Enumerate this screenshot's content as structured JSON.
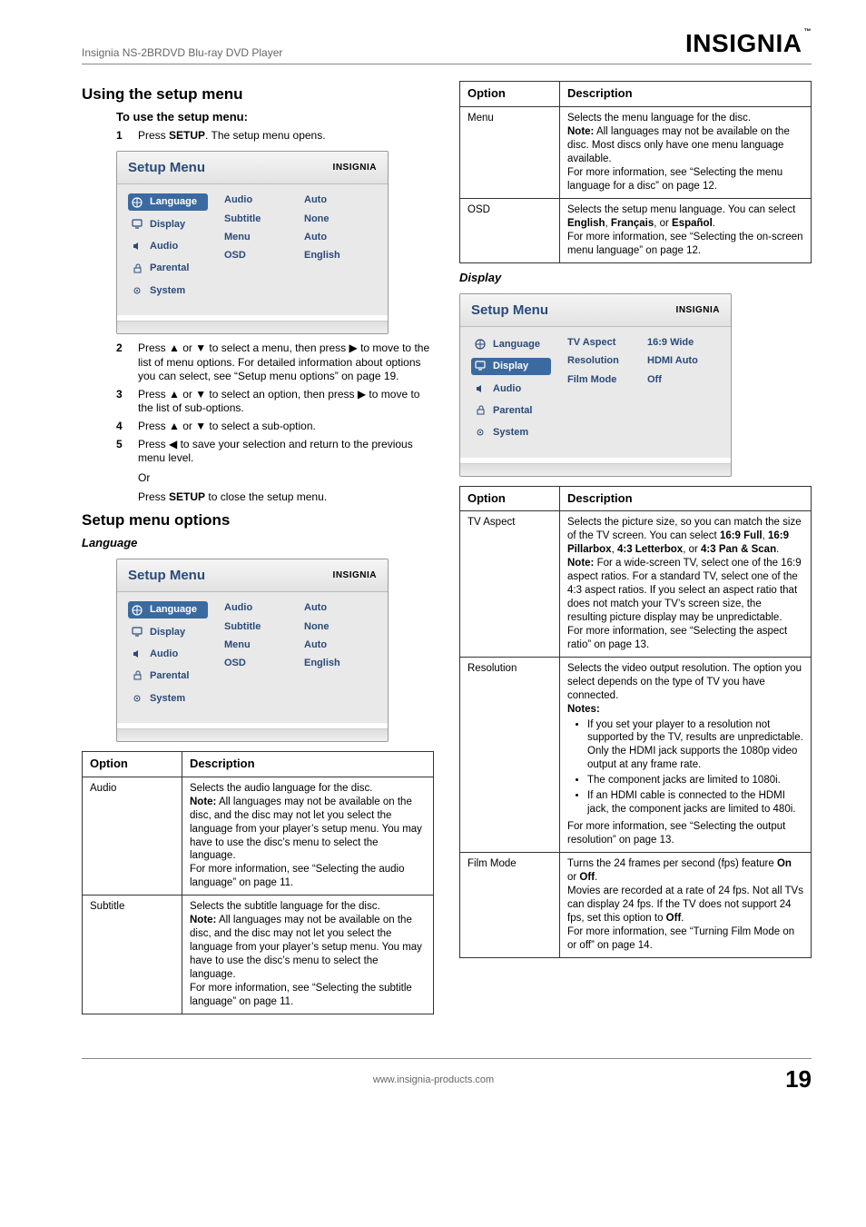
{
  "header": {
    "title": "Insignia NS-2BRDVD Blu-ray DVD Player",
    "brand": "INSIGNIA",
    "tm": "™"
  },
  "left": {
    "section_title": "Using the setup menu",
    "sub_title": "To use the setup menu:",
    "steps": {
      "s1": "Press SETUP. The setup menu opens.",
      "s1_pre": "Press ",
      "s1_bold": "SETUP",
      "s1_post": ". The setup menu opens.",
      "s2": "Press ▲ or ▼ to select a menu, then press ▶ to move to the list of menu options. For detailed information about options you can select, see “Setup menu options” on page 19.",
      "s3": "Press ▲ or ▼ to select an option, then press ▶ to move to the list of sub-options.",
      "s4": "Press ▲ or ▼ to select a sub-option.",
      "s5": "Press ◀ to save your selection and return to the previous menu level.",
      "or": "Or",
      "or2_pre": "Press ",
      "or2_bold": "SETUP",
      "or2_post": " to close the setup menu."
    },
    "options_title": "Setup menu options",
    "lang_heading": "Language",
    "table_headers": {
      "option": "Option",
      "description": "Description"
    },
    "rows": {
      "audio": {
        "name": "Audio",
        "p1": "Selects the audio language for the disc.",
        "note_label": "Note:",
        "note": " All languages may not be available on the disc, and the disc may not let you select the language from your player’s setup menu. You may have to use the disc’s menu to select the language.",
        "p2": "For more information, see “Selecting the audio language” on page 11."
      },
      "subtitle": {
        "name": "Subtitle",
        "p1": "Selects the subtitle language for the disc.",
        "note_label": "Note:",
        "note": " All languages may not be available on the disc, and the disc may not let you select the language from your player’s setup menu. You may have to use the disc’s menu to select the language.",
        "p2": "For more information, see “Selecting the subtitle language” on page 11."
      }
    }
  },
  "right": {
    "rows1": {
      "menu": {
        "name": "Menu",
        "p1": "Selects the menu language for the disc.",
        "note_label": "Note:",
        "note": " All languages may not be available on the disc. Most discs only have one menu language available.",
        "p2": "For more information, see “Selecting the menu language for a disc” on page 12."
      },
      "osd": {
        "name": "OSD",
        "p1_pre": "Selects the setup menu language. You can select ",
        "p1_b1": "English",
        "p1_c1": ", ",
        "p1_b2": "Français",
        "p1_c2": ", or ",
        "p1_b3": "Español",
        "p1_post": ".",
        "p2": "For more information, see “Selecting the on-screen menu language” on page 12."
      }
    },
    "display_heading": "Display",
    "table_headers": {
      "option": "Option",
      "description": "Description"
    },
    "rows2": {
      "tvaspect": {
        "name": "TV Aspect",
        "p1_pre": "Selects the picture size, so you can match the size of the TV screen. You can select ",
        "b1": "16:9 Full",
        "c1": ", ",
        "b2": "16:9 Pillarbox",
        "c2": ", ",
        "b3": "4:3 Letterbox",
        "c3": ", or ",
        "b4": "4:3 Pan & Scan",
        "post": ".",
        "note_label": "Note:",
        "note": " For a wide-screen TV, select one of the 16:9 aspect ratios. For a standard TV, select one of the 4:3 aspect ratios. If you select an aspect ratio that does not match your TV’s screen size, the resulting picture display may be unpredictable.",
        "p2": "For more information, see “Selecting the aspect ratio” on page 13."
      },
      "resolution": {
        "name": "Resolution",
        "p1": "Selects the video output resolution. The option you select depends on the type of TV you have connected.",
        "notes_label": "Notes:",
        "b1": "If you set your player to a resolution not supported by the TV, results are unpredictable. Only the HDMI jack supports the 1080p video output at any frame rate.",
        "b2": "The component jacks are limited to 1080i.",
        "b3": "If an HDMI cable is connected to the HDMI jack, the component jacks are limited to 480i.",
        "p2": "For more information, see “Selecting the output resolution” on page 13."
      },
      "filmmode": {
        "name": "Film Mode",
        "p1_pre": "Turns the 24 frames per second (fps) feature ",
        "b_on": "On",
        "c_or": " or ",
        "b_off": "Off",
        "p1_post": ".",
        "p2_pre": "Movies are recorded at a rate of 24 fps. Not all TVs can display 24 fps. If the TV does not support 24 fps, set this option to ",
        "b_off2": "Off",
        "p2_post": ".",
        "p3": "For more information, see “Turning Film Mode on or off” on page 14."
      }
    }
  },
  "setup_menu": {
    "title": "Setup Menu",
    "brand": "INSIGNIA",
    "nav": [
      "Language",
      "Display",
      "Audio",
      "Parental",
      "System"
    ],
    "lang_labels": [
      "Audio",
      "Subtitle",
      "Menu",
      "OSD"
    ],
    "lang_values": [
      "Auto",
      "None",
      "Auto",
      "English"
    ],
    "disp_labels": [
      "TV Aspect",
      "Resolution",
      "Film Mode"
    ],
    "disp_values": [
      "16:9 Wide",
      "HDMI Auto",
      "Off"
    ]
  },
  "footer": {
    "url": "www.insignia-products.com",
    "page": "19"
  }
}
